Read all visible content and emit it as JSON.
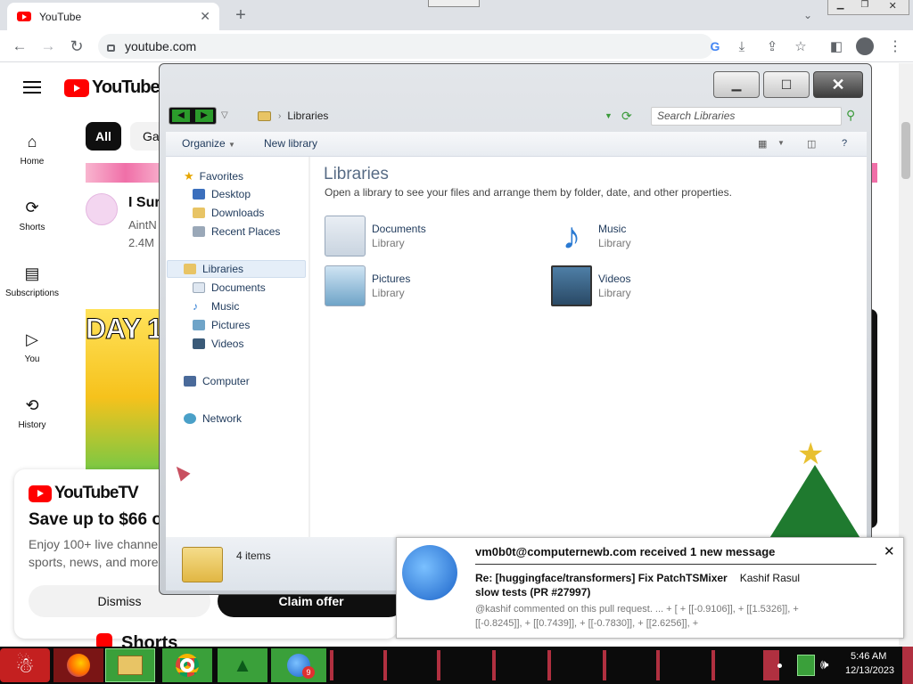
{
  "browser": {
    "tab_title": "YouTube",
    "url": "youtube.com"
  },
  "youtube": {
    "logo": "YouTube",
    "nav": [
      {
        "label": "Home",
        "icon": "home-icon"
      },
      {
        "label": "Shorts",
        "icon": "shorts-icon"
      },
      {
        "label": "Subscriptions",
        "icon": "subscriptions-icon"
      },
      {
        "label": "You",
        "icon": "you-icon"
      },
      {
        "label": "History",
        "icon": "history-icon"
      }
    ],
    "chips": [
      "All",
      "Ga"
    ],
    "video": {
      "title": "I Sur",
      "channel": "AintN",
      "views": "2.4M"
    },
    "thumb_text": "DAY 1",
    "promo": {
      "logo": "YouTubeTV",
      "headline": "Save up to $66 o",
      "body1": "Enjoy 100+ live channel",
      "body2": "sports, news, and more",
      "dismiss": "Dismiss",
      "claim": "Claim offer"
    },
    "shorts_heading": "Shorts"
  },
  "explorer": {
    "address": "Libraries",
    "search_placeholder": "Search Libraries",
    "toolbar": {
      "organize": "Organize",
      "new_library": "New library",
      "help": "?"
    },
    "nav": {
      "favorites": "Favorites",
      "fav_items": [
        "Desktop",
        "Downloads",
        "Recent Places"
      ],
      "libraries": "Libraries",
      "lib_items": [
        "Documents",
        "Music",
        "Pictures",
        "Videos"
      ],
      "computer": "Computer",
      "network": "Network"
    },
    "heading": "Libraries",
    "subheading": "Open a library to see your files and arrange them by folder, date, and other properties.",
    "items": [
      {
        "name": "Documents",
        "type": "Library"
      },
      {
        "name": "Music",
        "type": "Library"
      },
      {
        "name": "Pictures",
        "type": "Library"
      },
      {
        "name": "Videos",
        "type": "Library"
      }
    ],
    "status": "4 items"
  },
  "notification": {
    "header": "vm0b0t@computernewb.com received 1 new message",
    "subject1": "Re: [huggingface/transformers] Fix PatchTSMixer",
    "sender": "Kashif Rasul",
    "subject2": "slow tests (PR #27997)",
    "preview1": "@kashif commented on this pull request. ... + [ + [[-0.9106]], + [[1.5326]], +",
    "preview2": "[[-0.8245]], + [[0.7439]], + [[-0.7830]], + [[2.6256]], +"
  },
  "taskbar": {
    "time": "5:46 AM",
    "date": "12/13/2023",
    "thunderbird_badge": "9"
  }
}
